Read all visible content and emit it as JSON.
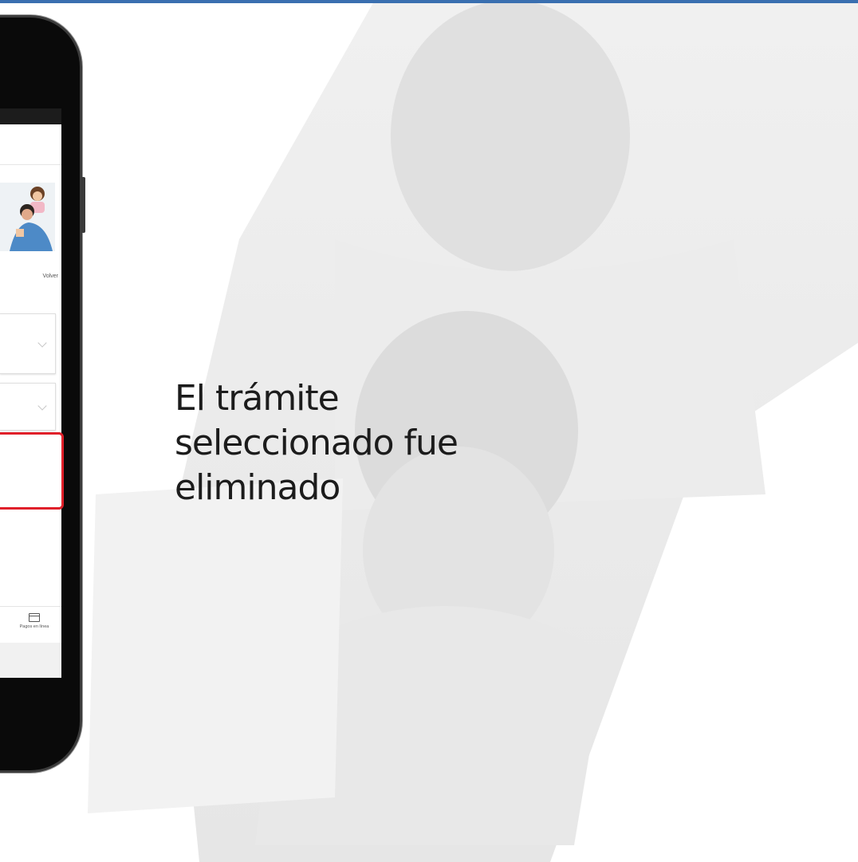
{
  "slide": {
    "message": "El trámite seleccionado fue eliminado"
  },
  "phone": {
    "volver_label": "Volver",
    "nav": {
      "payments_label": "Pagos en línea",
      "payments_icon": "credit-card-icon"
    }
  },
  "colors": {
    "top_bar": "#3a6fb0",
    "highlight": "#e0202a",
    "text": "#1c1c1c"
  }
}
